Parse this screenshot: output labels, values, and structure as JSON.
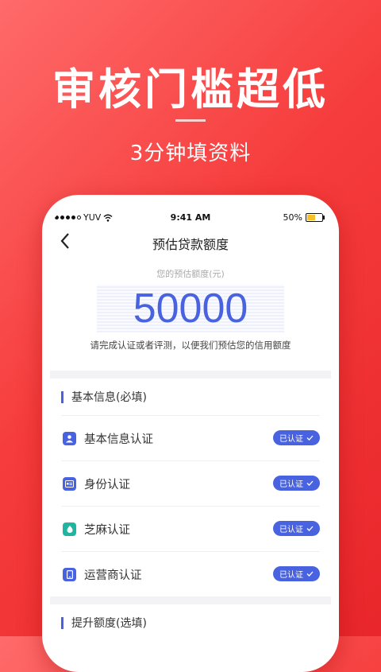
{
  "promo": {
    "title": "审核门槛超低",
    "subtitle": "3分钟填资料"
  },
  "status_bar": {
    "carrier": "YUV",
    "time": "9:41 AM",
    "battery": "50%"
  },
  "nav": {
    "title": "预估贷款额度"
  },
  "estimate": {
    "label": "您的预估额度(元)",
    "amount": "50000",
    "note": "请完成认证或者评测，以便我们预估您的信用额度"
  },
  "sections": {
    "basic_title": "基本信息(必填)",
    "upgrade_title": "提升额度(选填)"
  },
  "items": [
    {
      "label": "基本信息认证",
      "badge": "已认证",
      "icon": "person-icon",
      "color": "#4963e0"
    },
    {
      "label": "身份认证",
      "badge": "已认证",
      "icon": "id-card-icon",
      "color": "#4963e0"
    },
    {
      "label": "芝麻认证",
      "badge": "已认证",
      "icon": "sesame-icon",
      "color": "#1fb5a0"
    },
    {
      "label": "运营商认证",
      "badge": "已认证",
      "icon": "phone-icon",
      "color": "#4963e0"
    }
  ],
  "colors": {
    "accent": "#4963e0",
    "background_red": "#f63c3c"
  }
}
